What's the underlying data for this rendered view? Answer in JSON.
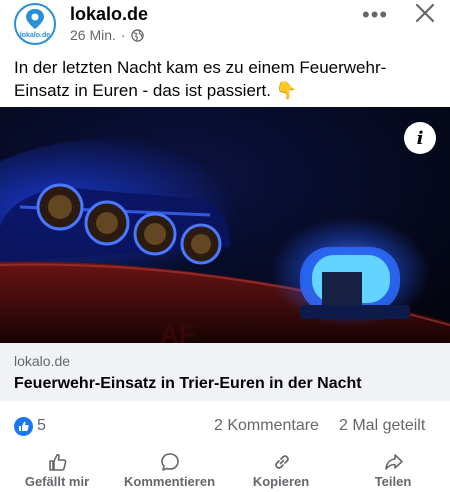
{
  "header": {
    "page_name": "lokalo.de",
    "avatar_text": "lokalo.de",
    "time": "26 Min.",
    "separator": "·",
    "audience_icon": "globe-icon",
    "more_icon": "more-icon",
    "close_icon": "close-icon"
  },
  "post": {
    "text": "In der letzten Nacht kam es zu einem Feuerwehr-Einsatz in Euren - das ist passiert. 👇"
  },
  "image": {
    "info_label": "i"
  },
  "link": {
    "domain": "lokalo.de",
    "title": "Feuerwehr-Einsatz in Trier-Euren in der Nacht"
  },
  "stats": {
    "reaction_icon": "like-icon",
    "likes": "5",
    "comments": "2 Kommentare",
    "shares": "2 Mal geteilt"
  },
  "actions": [
    {
      "label": "Gefällt mir",
      "icon": "thumbs-up-icon"
    },
    {
      "label": "Kommentieren",
      "icon": "comment-icon"
    },
    {
      "label": "Kopieren",
      "icon": "link-icon"
    },
    {
      "label": "Teilen",
      "icon": "share-icon"
    }
  ],
  "colors": {
    "accent": "#1877f2",
    "secondary_text": "#65676b",
    "link_card_bg": "#f0f2f5",
    "image_blue": "#2f6bff"
  }
}
